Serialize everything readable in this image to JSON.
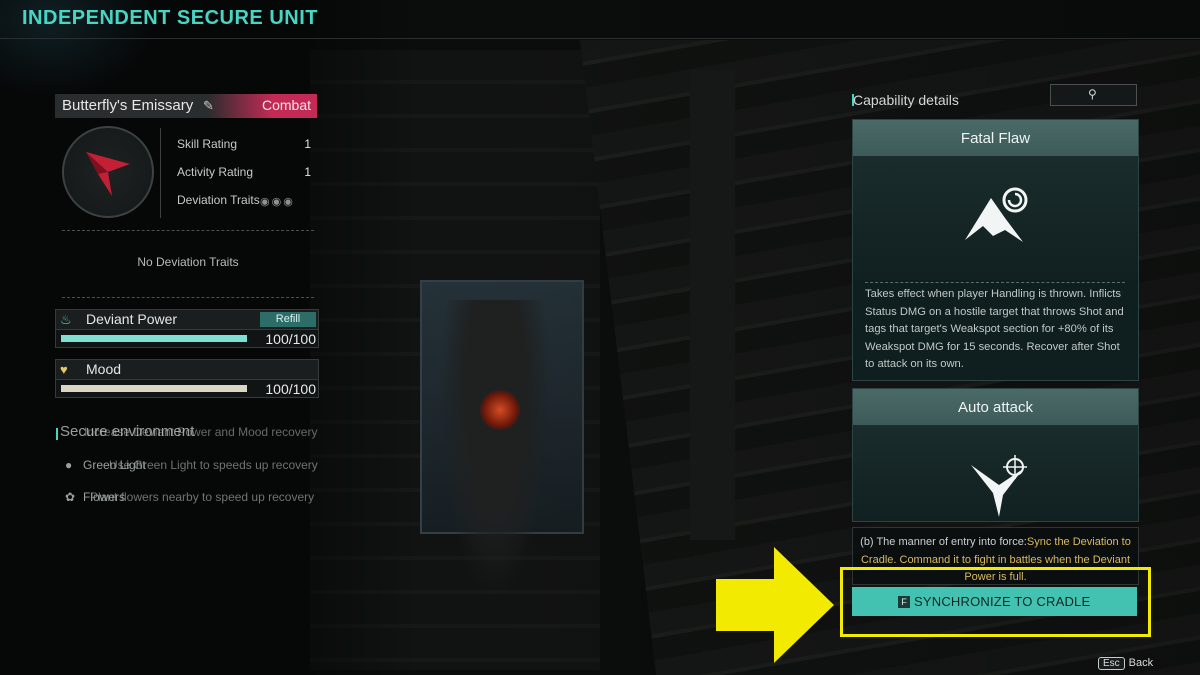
{
  "header": {
    "title": "INDEPENDENT SECURE UNIT"
  },
  "deviation": {
    "name": "Butterfly's Emissary",
    "category": "Combat",
    "stats": [
      {
        "label": "Skill Rating",
        "value": "1"
      },
      {
        "label": "Activity Rating",
        "value": "1"
      }
    ],
    "traits_label": "Deviation Traits",
    "no_traits": "No Deviation Traits"
  },
  "resources": {
    "deviant_power": {
      "label": "Deviant Power",
      "value": "100/100",
      "fill": 1.0,
      "refill_label": "Refill"
    },
    "mood": {
      "label": "Mood",
      "value": "100/100",
      "fill": 1.0
    }
  },
  "secure_environment": {
    "title": "Secure environment",
    "overlay_text": "Increase Deviant Power and Mood recovery",
    "items": [
      {
        "label": "Green Light",
        "desc": "Use Green Light to speeds up recovery",
        "icon": "lightbulb-icon"
      },
      {
        "label": "Flowers",
        "desc": "Plant flowers nearby to speed up recovery",
        "icon": "flower-icon"
      }
    ]
  },
  "capability": {
    "title": "Capability details",
    "cards": [
      {
        "title": "Fatal Flaw",
        "icon": "fatal-flaw-icon",
        "description": "Takes effect when player Handling is thrown. Inflicts Status DMG on a hostile target that throws Shot and tags that target's Weakspot section for +80% of its Weakspot DMG for 15 seconds. Recover after Shot to attack on its own."
      },
      {
        "title": "Auto attack",
        "icon": "auto-attack-icon",
        "description": ""
      }
    ],
    "entry_prefix": "(b) The manner of entry into force:",
    "entry_highlight": "Sync the Deviation to Cradle. Command it to fight in battles when the Deviant Power is full.",
    "sync_key": "F",
    "sync_label": "SYNCHRONIZE TO CRADLE"
  },
  "footer": {
    "esc_key": "Esc",
    "back_label": "Back"
  },
  "colors": {
    "accent": "#48d6c4",
    "combat": "#c42a56",
    "highlight": "#f2ea00",
    "sync_button": "#44c2b1"
  }
}
